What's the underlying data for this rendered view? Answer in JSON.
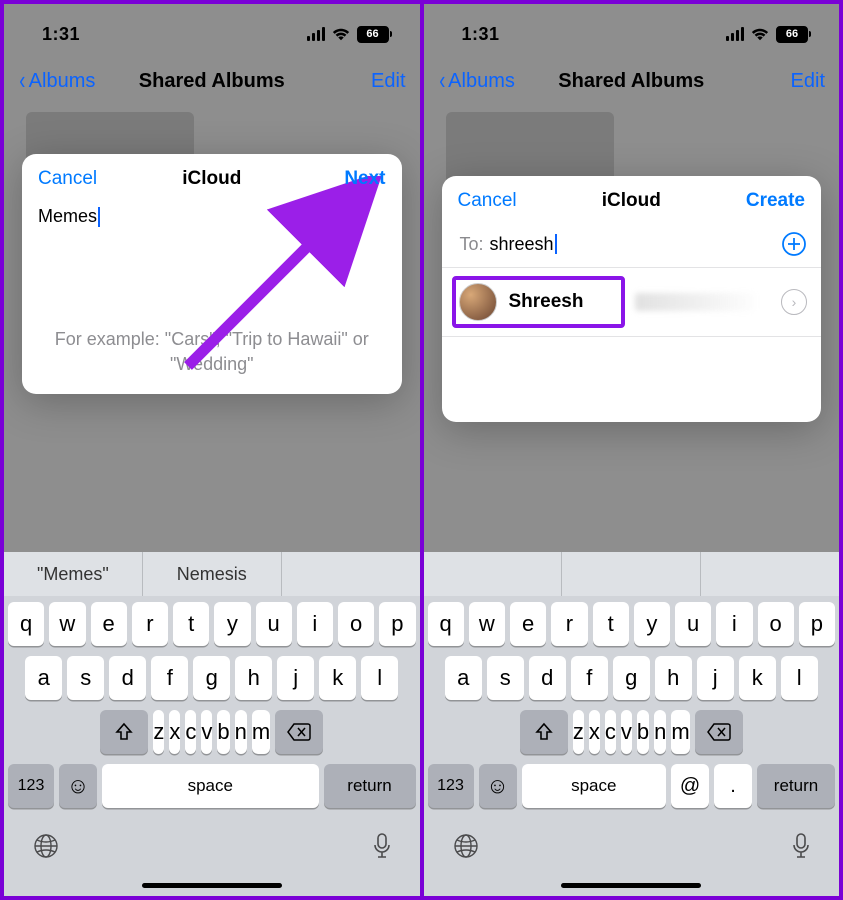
{
  "status": {
    "time": "1:31",
    "battery": "66"
  },
  "nav": {
    "back": "Albums",
    "title": "Shared Albums",
    "edit": "Edit"
  },
  "left": {
    "modal": {
      "cancel": "Cancel",
      "title": "iCloud",
      "next": "Next",
      "album_name": "Memes",
      "example": "For example: \"Cars\", \"Trip to Hawaii\" or \"Wedding\""
    },
    "suggestions": [
      "\"Memes\"",
      "Nemesis",
      ""
    ]
  },
  "right": {
    "modal": {
      "cancel": "Cancel",
      "title": "iCloud",
      "create": "Create",
      "to_label": "To:",
      "to_value": "shreesh",
      "contact_name": "Shreesh"
    },
    "suggestions": [
      "",
      "",
      ""
    ]
  },
  "keys": {
    "row1": [
      "q",
      "w",
      "e",
      "r",
      "t",
      "y",
      "u",
      "i",
      "o",
      "p"
    ],
    "row2": [
      "a",
      "s",
      "d",
      "f",
      "g",
      "h",
      "j",
      "k",
      "l"
    ],
    "row3": [
      "z",
      "x",
      "c",
      "v",
      "b",
      "n",
      "m"
    ],
    "sym": "123",
    "space": "space",
    "return": "return",
    "at": "@",
    "dot": "."
  }
}
